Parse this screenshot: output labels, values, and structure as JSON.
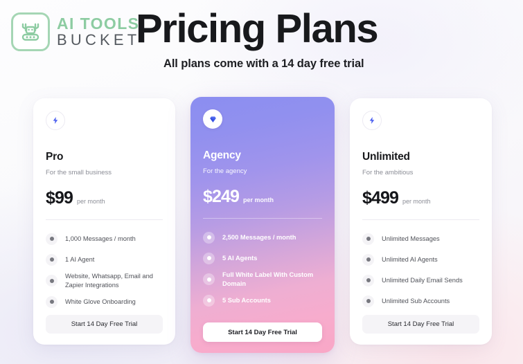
{
  "brand": {
    "logo_icon": "robot-icon",
    "line1": "AI TOOLS",
    "line2": "BUCKET",
    "accent_color": "#8dcca2"
  },
  "header": {
    "title": "Pricing Plans",
    "subtitle": "All plans come with a 14 day free trial"
  },
  "plans": [
    {
      "icon": "lightning-bolt-icon",
      "name": "Pro",
      "tagline": "For the small business",
      "price": "$99",
      "period": "per month",
      "features": [
        "1,000 Messages / month",
        "1 AI Agent",
        "Website, Whatsapp, Email and Zapier Integrations",
        "White Glove Onboarding"
      ],
      "cta": "Start 14 Day Free Trial",
      "featured": false
    },
    {
      "icon": "diamond-icon",
      "name": "Agency",
      "tagline": "For the agency",
      "price": "$249",
      "period": "per month",
      "features": [
        "2,500 Messages / month",
        "5 AI Agents",
        "Full White Label With Custom Domain",
        "5 Sub Accounts"
      ],
      "cta": "Start 14 Day Free Trial",
      "featured": true
    },
    {
      "icon": "lightning-bolt-icon",
      "name": "Unlimited",
      "tagline": "For the ambitious",
      "price": "$499",
      "period": "per month",
      "features": [
        "Unlimited Messages",
        "Unlimited AI Agents",
        "Unlimited Daily Email Sends",
        "Unlimited Sub Accounts"
      ],
      "cta": "Start 14 Day Free Trial",
      "featured": false
    }
  ],
  "colors": {
    "icon_blue": "#4a5ef0",
    "featured_gradient_start": "#8b8ef0",
    "featured_gradient_end": "#f9a7c6"
  }
}
